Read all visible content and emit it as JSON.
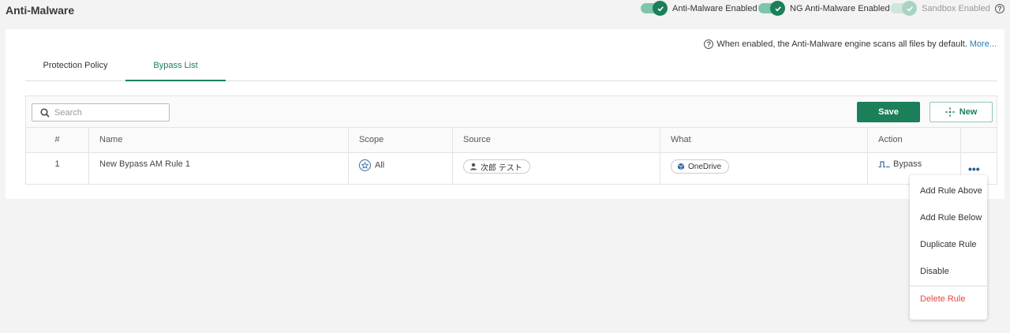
{
  "header": {
    "title": "Anti-Malware",
    "toggles": [
      {
        "label": "Anti-Malware Enabled",
        "state": "on"
      },
      {
        "label": "NG Anti-Malware Enabled",
        "state": "on"
      },
      {
        "label": "Sandbox Enabled",
        "state": "disabled"
      }
    ]
  },
  "info": {
    "text": "When enabled, the Anti-Malware engine scans all files by default.",
    "link": "More..."
  },
  "tabs": [
    {
      "label": "Protection Policy",
      "active": false
    },
    {
      "label": "Bypass List",
      "active": true
    }
  ],
  "toolbar": {
    "search_placeholder": "Search",
    "save_label": "Save",
    "new_label": "New"
  },
  "table": {
    "columns": [
      "#",
      "Name",
      "Scope",
      "Source",
      "What",
      "Action"
    ],
    "rows": [
      {
        "num": "1",
        "name": "New Bypass AM Rule 1",
        "scope": "All",
        "source": "次郎 テスト",
        "what": "OneDrive",
        "action": "Bypass"
      }
    ]
  },
  "context_menu": {
    "items": [
      "Add Rule Above",
      "Add Rule Below",
      "Duplicate Rule",
      "Disable"
    ],
    "danger_item": "Delete Rule"
  },
  "colors": {
    "accent": "#1b7f5a",
    "toggle_track": "#7cc7a9",
    "link": "#2a7ab8",
    "danger": "#e04848"
  }
}
